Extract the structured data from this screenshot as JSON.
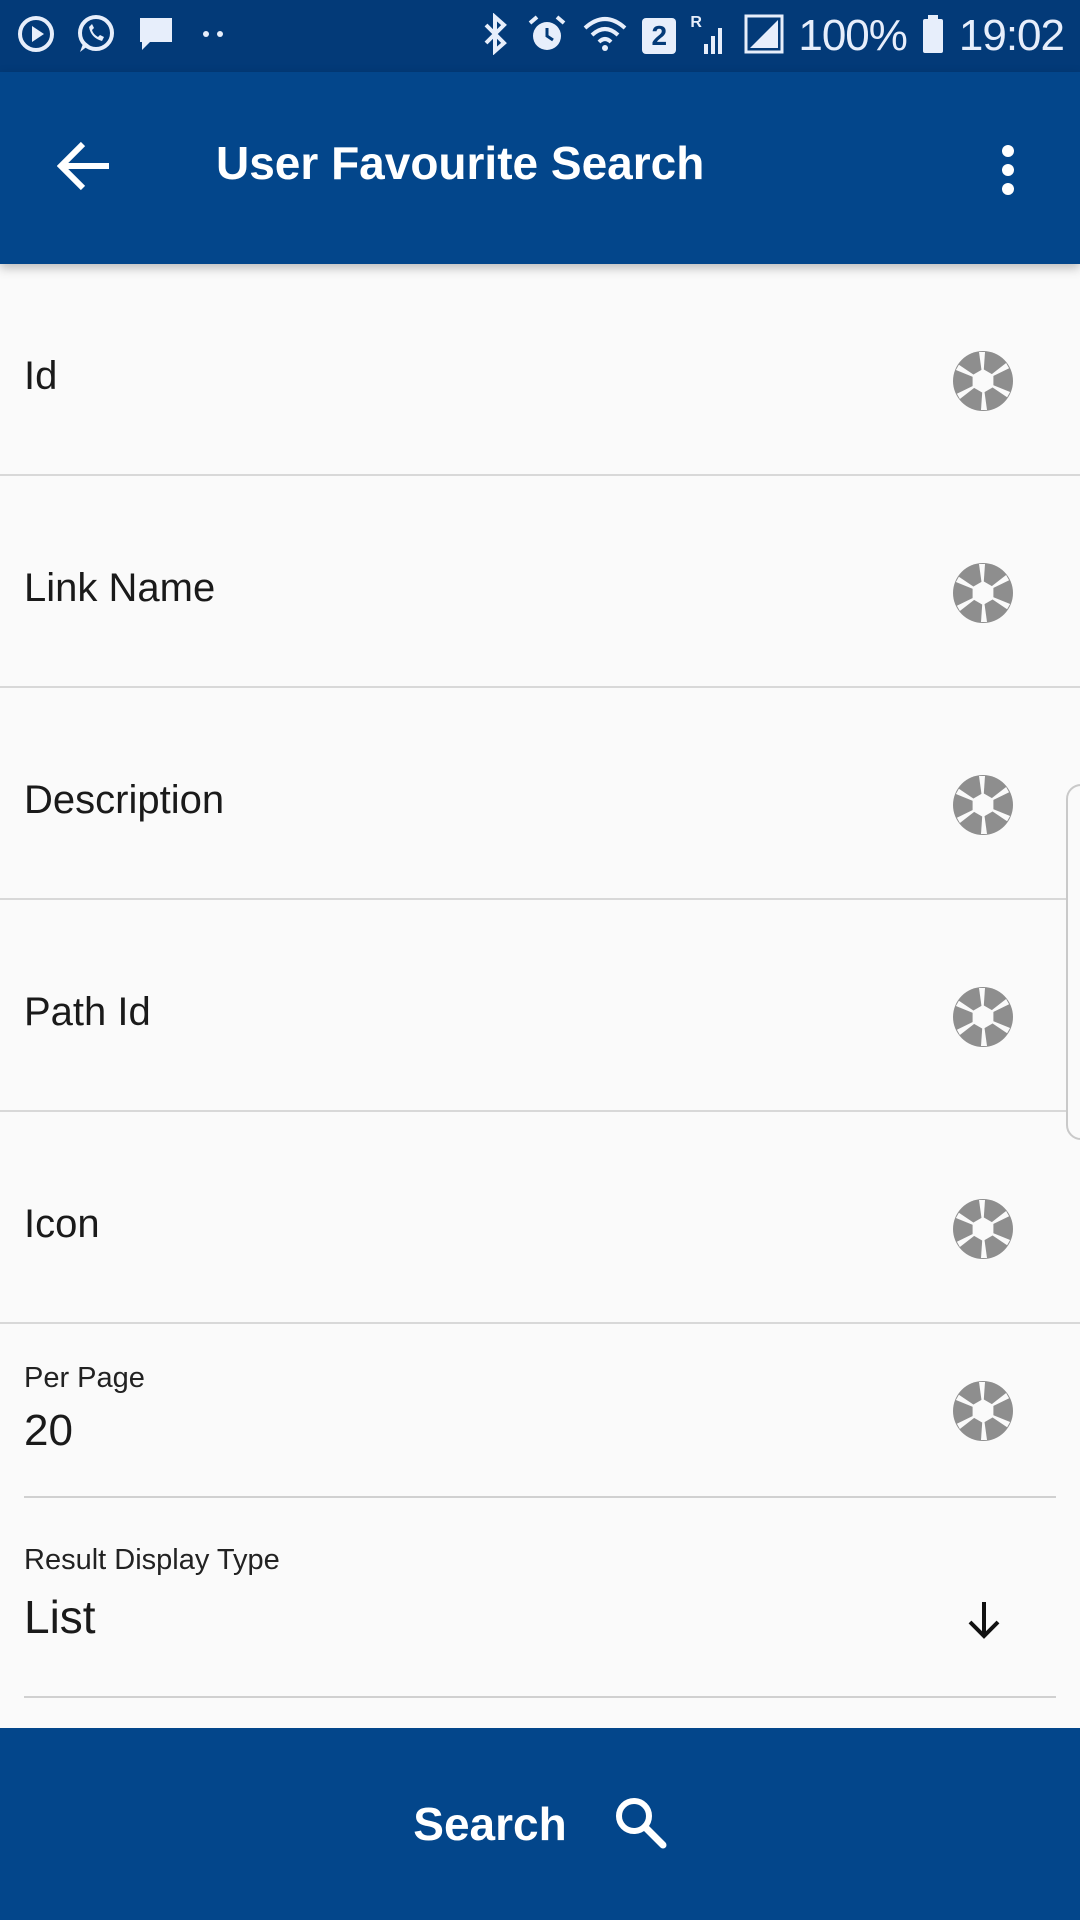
{
  "status_bar": {
    "battery_percent": "100%",
    "time": "19:02",
    "sim_badge": "2",
    "roaming_label": "R"
  },
  "app_bar": {
    "title": "User Favourite Search"
  },
  "form": {
    "rows": [
      {
        "label": "Id"
      },
      {
        "label": "Link Name"
      },
      {
        "label": "Description"
      },
      {
        "label": "Path Id"
      },
      {
        "label": "Icon"
      }
    ],
    "per_page": {
      "label": "Per Page",
      "value": "20"
    },
    "result_display_type": {
      "label": "Result Display Type",
      "value": "List"
    }
  },
  "footer": {
    "search_label": "Search"
  },
  "colors": {
    "status_bar_bg": "#033a78",
    "primary": "#03468b",
    "icon_gray": "#8e8e8e"
  }
}
